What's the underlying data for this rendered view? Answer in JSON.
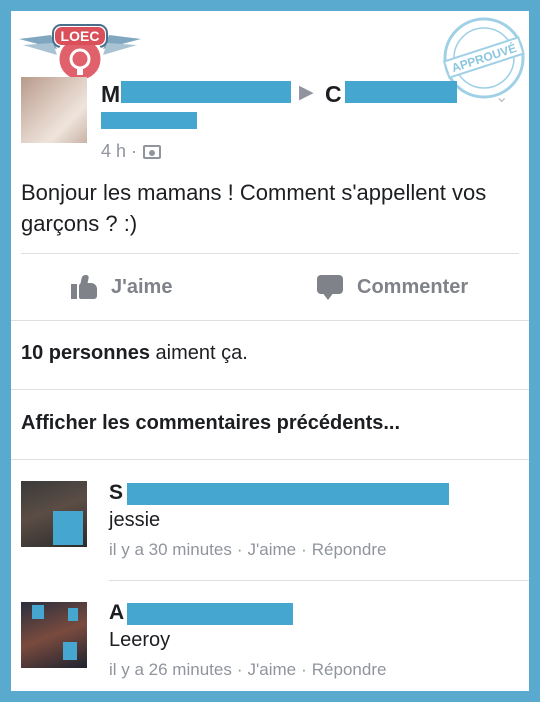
{
  "brand": {
    "logo_text": "LOEC",
    "stamp_text": "APPROUVÉ"
  },
  "post": {
    "author_initial": "M",
    "target_initial": "C",
    "separator_glyph": "▶",
    "options_glyph": "⌄",
    "time": "4 h ·",
    "text": "Bonjour les mamans ! Comment s'appellent vos garçons ? :)"
  },
  "actions": {
    "like_label": "J'aime",
    "comment_label": "Commenter"
  },
  "likes_summary": {
    "count": "10 personnes",
    "rest": " aiment ça."
  },
  "previous_comments_label": "Afficher les commentaires précédents...",
  "comments": [
    {
      "author_initial": "S",
      "text": "jessie",
      "time": "il y a 30 minutes",
      "like": "J'aime",
      "reply": "Répondre",
      "sep": "·"
    },
    {
      "author_initial": "A",
      "text": "Leeroy",
      "time": "il y a 26 minutes",
      "like": "J'aime",
      "reply": "Répondre",
      "sep": "·"
    }
  ],
  "colors": {
    "frame": "#5aa9cf",
    "redaction": "#45a7cf",
    "text": "#1c1e21",
    "muted": "#90949c",
    "icon": "#7f8389"
  }
}
